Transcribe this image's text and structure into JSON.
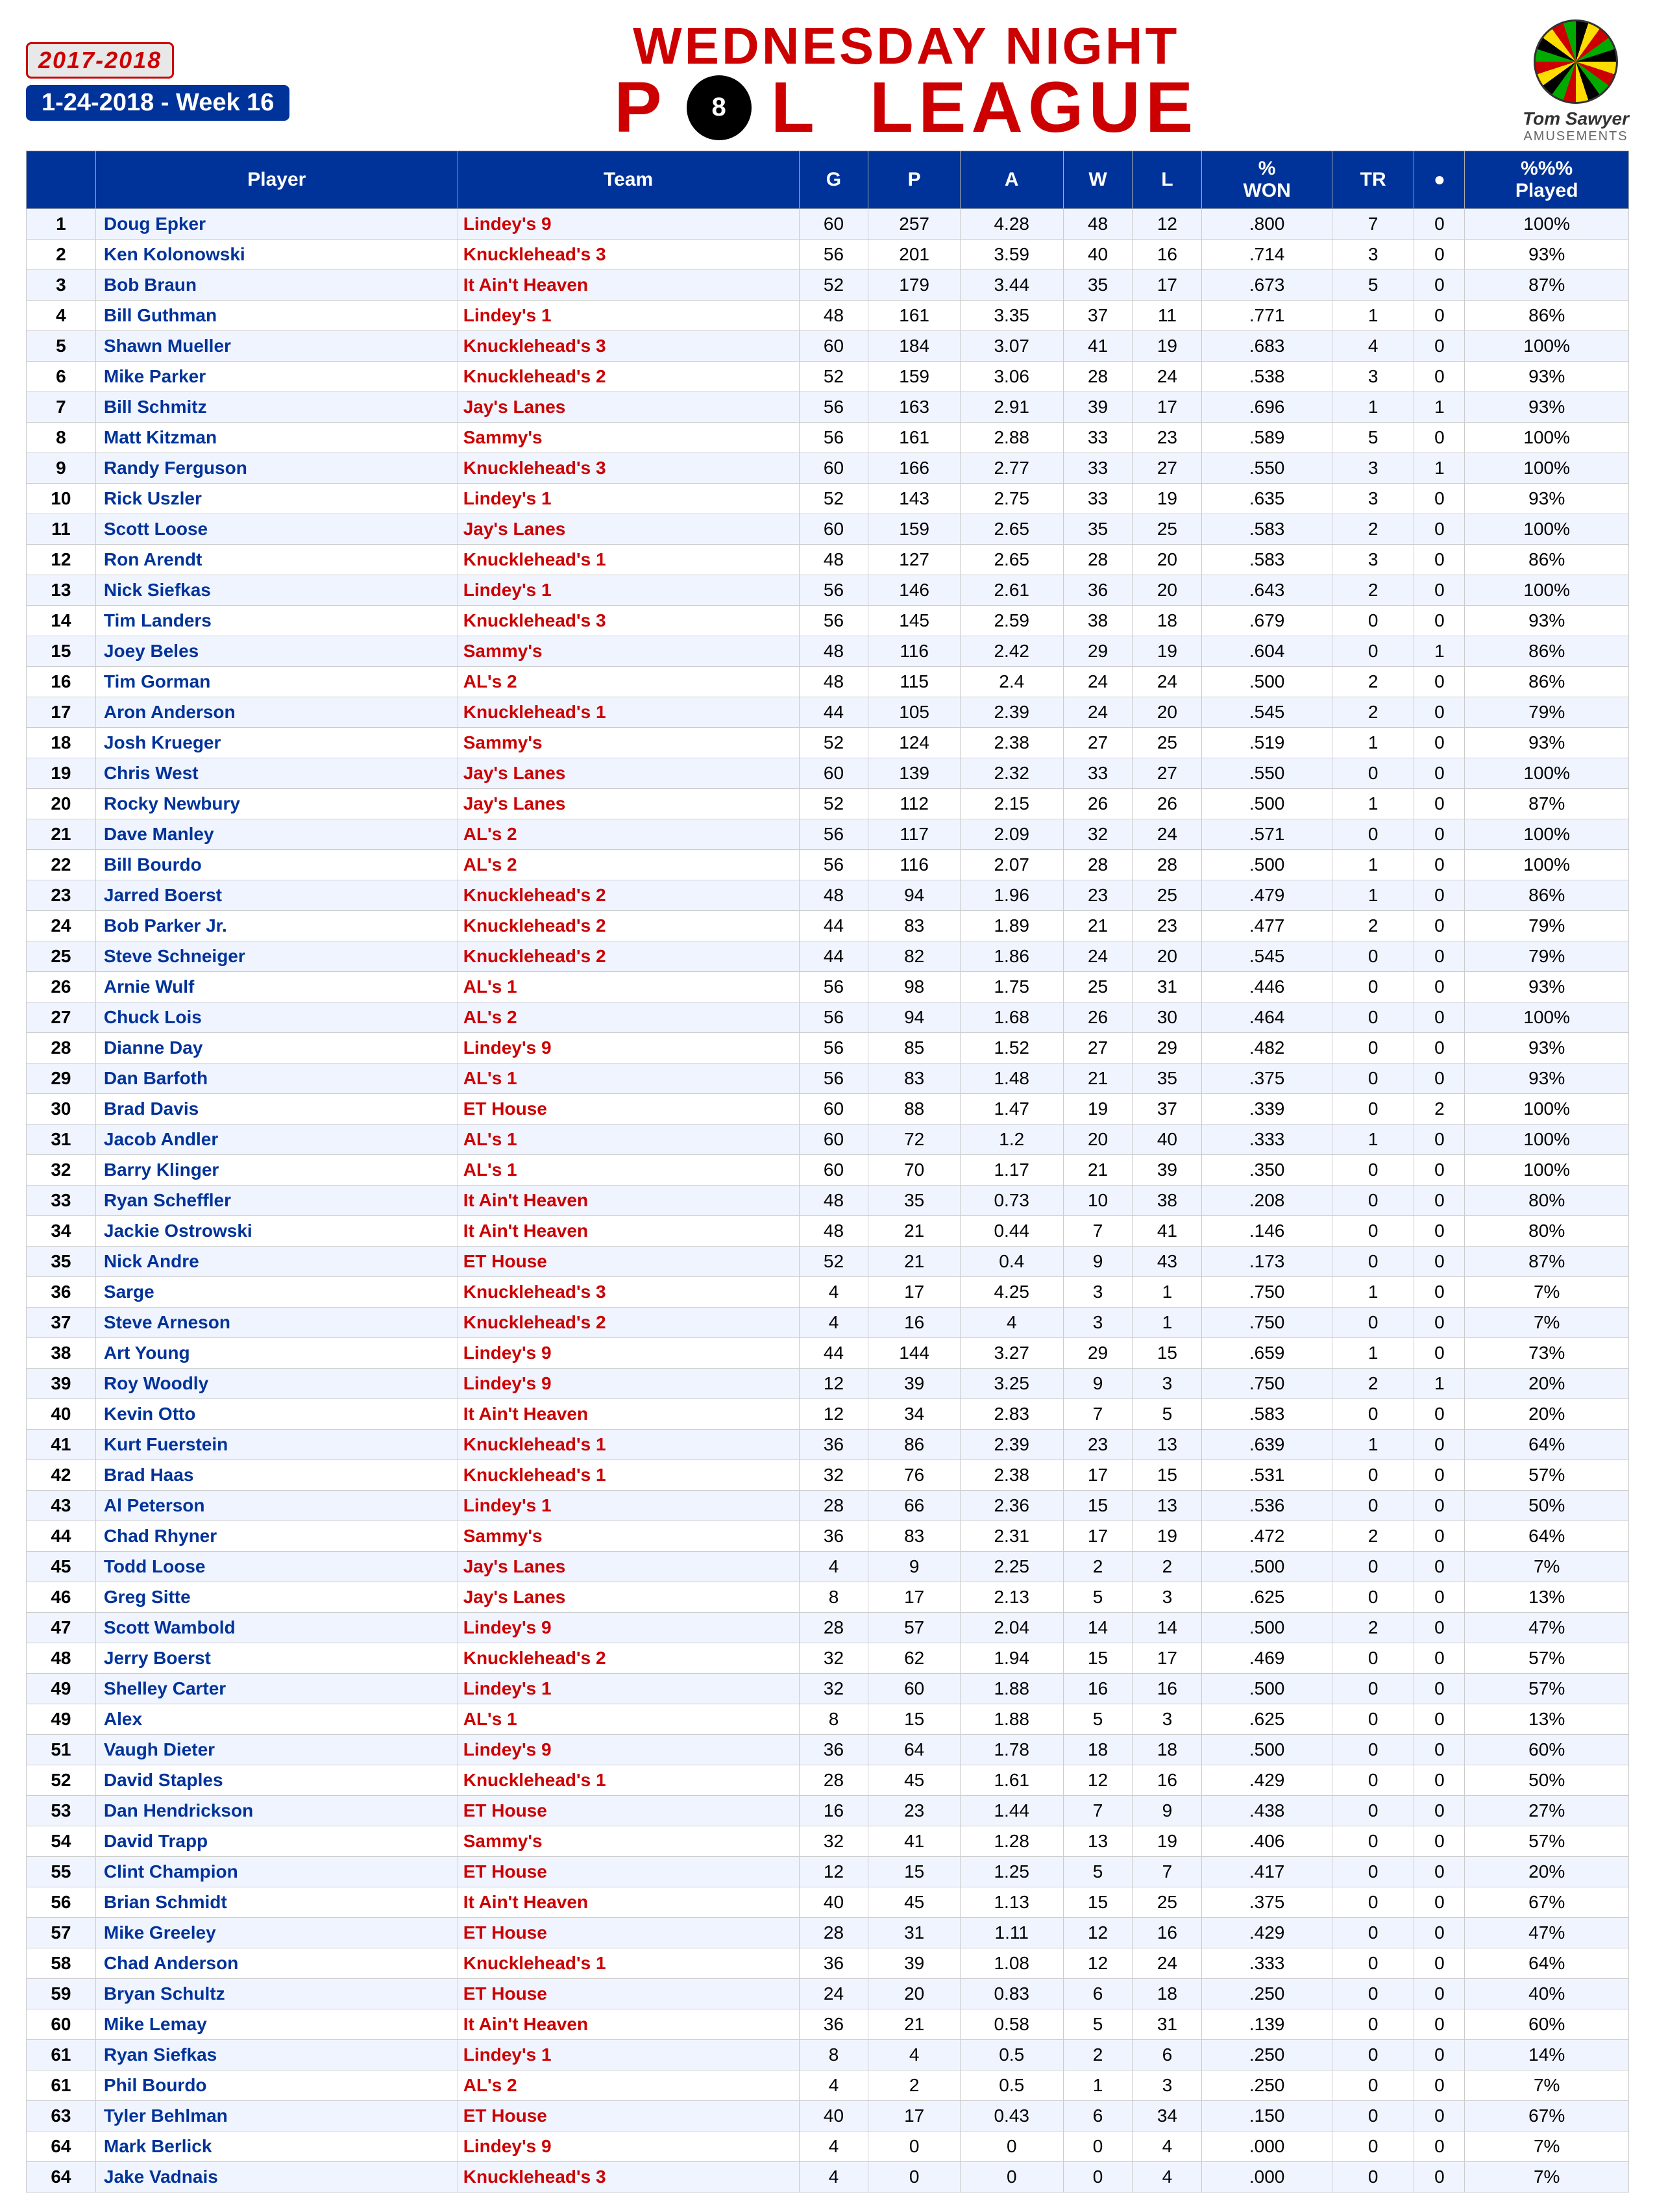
{
  "header": {
    "year": "2017-2018",
    "week": "1-24-2018 - Week 16",
    "title1": "WEDNESDAY NIGHT",
    "title2": "P",
    "title3": "L LEAGUE",
    "brand": "Tom Sawyer",
    "brand_sub": "AMUSEMENTS"
  },
  "columns": [
    "",
    "Player",
    "Team",
    "G",
    "P",
    "A",
    "W",
    "L",
    "% WON",
    "TR",
    "8",
    "%%% Played"
  ],
  "rows": [
    [
      1,
      "Doug Epker",
      "Lindey's 9",
      60,
      257,
      4.28,
      48,
      12,
      ".800",
      7,
      0,
      "100%"
    ],
    [
      2,
      "Ken Kolonowski",
      "Knucklehead's 3",
      56,
      201,
      3.59,
      40,
      16,
      ".714",
      3,
      0,
      "93%"
    ],
    [
      3,
      "Bob Braun",
      "It Ain't Heaven",
      52,
      179,
      3.44,
      35,
      17,
      ".673",
      5,
      0,
      "87%"
    ],
    [
      4,
      "Bill Guthman",
      "Lindey's 1",
      48,
      161,
      3.35,
      37,
      11,
      ".771",
      1,
      0,
      "86%"
    ],
    [
      5,
      "Shawn Mueller",
      "Knucklehead's 3",
      60,
      184,
      3.07,
      41,
      19,
      ".683",
      4,
      0,
      "100%"
    ],
    [
      6,
      "Mike Parker",
      "Knucklehead's 2",
      52,
      159,
      3.06,
      28,
      24,
      ".538",
      3,
      0,
      "93%"
    ],
    [
      7,
      "Bill Schmitz",
      "Jay's Lanes",
      56,
      163,
      2.91,
      39,
      17,
      ".696",
      1,
      1,
      "93%"
    ],
    [
      8,
      "Matt Kitzman",
      "Sammy's",
      56,
      161,
      2.88,
      33,
      23,
      ".589",
      5,
      0,
      "100%"
    ],
    [
      9,
      "Randy Ferguson",
      "Knucklehead's 3",
      60,
      166,
      2.77,
      33,
      27,
      ".550",
      3,
      1,
      "100%"
    ],
    [
      10,
      "Rick Uszler",
      "Lindey's 1",
      52,
      143,
      2.75,
      33,
      19,
      ".635",
      3,
      0,
      "93%"
    ],
    [
      11,
      "Scott Loose",
      "Jay's Lanes",
      60,
      159,
      2.65,
      35,
      25,
      ".583",
      2,
      0,
      "100%"
    ],
    [
      12,
      "Ron Arendt",
      "Knucklehead's 1",
      48,
      127,
      2.65,
      28,
      20,
      ".583",
      3,
      0,
      "86%"
    ],
    [
      13,
      "Nick Siefkas",
      "Lindey's 1",
      56,
      146,
      2.61,
      36,
      20,
      ".643",
      2,
      0,
      "100%"
    ],
    [
      14,
      "Tim Landers",
      "Knucklehead's 3",
      56,
      145,
      2.59,
      38,
      18,
      ".679",
      0,
      0,
      "93%"
    ],
    [
      15,
      "Joey Beles",
      "Sammy's",
      48,
      116,
      2.42,
      29,
      19,
      ".604",
      0,
      1,
      "86%"
    ],
    [
      16,
      "Tim Gorman",
      "AL's 2",
      48,
      115,
      2.4,
      24,
      24,
      ".500",
      2,
      0,
      "86%"
    ],
    [
      17,
      "Aron Anderson",
      "Knucklehead's 1",
      44,
      105,
      2.39,
      24,
      20,
      ".545",
      2,
      0,
      "79%"
    ],
    [
      18,
      "Josh Krueger",
      "Sammy's",
      52,
      124,
      2.38,
      27,
      25,
      ".519",
      1,
      0,
      "93%"
    ],
    [
      19,
      "Chris West",
      "Jay's Lanes",
      60,
      139,
      2.32,
      33,
      27,
      ".550",
      0,
      0,
      "100%"
    ],
    [
      20,
      "Rocky Newbury",
      "Jay's Lanes",
      52,
      112,
      2.15,
      26,
      26,
      ".500",
      1,
      0,
      "87%"
    ],
    [
      21,
      "Dave Manley",
      "AL's 2",
      56,
      117,
      2.09,
      32,
      24,
      ".571",
      0,
      0,
      "100%"
    ],
    [
      22,
      "Bill Bourdo",
      "AL's 2",
      56,
      116,
      2.07,
      28,
      28,
      ".500",
      1,
      0,
      "100%"
    ],
    [
      23,
      "Jarred Boerst",
      "Knucklehead's 2",
      48,
      94,
      1.96,
      23,
      25,
      ".479",
      1,
      0,
      "86%"
    ],
    [
      24,
      "Bob Parker Jr.",
      "Knucklehead's 2",
      44,
      83,
      1.89,
      21,
      23,
      ".477",
      2,
      0,
      "79%"
    ],
    [
      25,
      "Steve Schneiger",
      "Knucklehead's 2",
      44,
      82,
      1.86,
      24,
      20,
      ".545",
      0,
      0,
      "79%"
    ],
    [
      26,
      "Arnie Wulf",
      "AL's 1",
      56,
      98,
      1.75,
      25,
      31,
      ".446",
      0,
      0,
      "93%"
    ],
    [
      27,
      "Chuck Lois",
      "AL's 2",
      56,
      94,
      1.68,
      26,
      30,
      ".464",
      0,
      0,
      "100%"
    ],
    [
      28,
      "Dianne Day",
      "Lindey's 9",
      56,
      85,
      1.52,
      27,
      29,
      ".482",
      0,
      0,
      "93%"
    ],
    [
      29,
      "Dan Barfoth",
      "AL's 1",
      56,
      83,
      1.48,
      21,
      35,
      ".375",
      0,
      0,
      "93%"
    ],
    [
      30,
      "Brad Davis",
      "ET House",
      60,
      88,
      1.47,
      19,
      37,
      ".339",
      0,
      2,
      "100%"
    ],
    [
      31,
      "Jacob Andler",
      "AL's 1",
      60,
      72,
      1.2,
      20,
      40,
      ".333",
      1,
      0,
      "100%"
    ],
    [
      32,
      "Barry Klinger",
      "AL's 1",
      60,
      70,
      1.17,
      21,
      39,
      ".350",
      0,
      0,
      "100%"
    ],
    [
      33,
      "Ryan Scheffler",
      "It Ain't Heaven",
      48,
      35,
      0.73,
      10,
      38,
      ".208",
      0,
      0,
      "80%"
    ],
    [
      34,
      "Jackie Ostrowski",
      "It Ain't Heaven",
      48,
      21,
      0.44,
      7,
      41,
      ".146",
      0,
      0,
      "80%"
    ],
    [
      35,
      "Nick Andre",
      "ET House",
      52,
      21,
      0.4,
      9,
      43,
      ".173",
      0,
      0,
      "87%"
    ],
    [
      36,
      "Sarge",
      "Knucklehead's 3",
      4,
      17,
      4.25,
      3,
      1,
      ".750",
      1,
      0,
      "7%"
    ],
    [
      37,
      "Steve Arneson",
      "Knucklehead's 2",
      4,
      16,
      4.0,
      3,
      1,
      ".750",
      0,
      0,
      "7%"
    ],
    [
      38,
      "Art Young",
      "Lindey's 9",
      44,
      144,
      3.27,
      29,
      15,
      ".659",
      1,
      0,
      "73%"
    ],
    [
      39,
      "Roy Woodly",
      "Lindey's 9",
      12,
      39,
      3.25,
      9,
      3,
      ".750",
      2,
      1,
      "20%"
    ],
    [
      40,
      "Kevin Otto",
      "It Ain't Heaven",
      12,
      34,
      2.83,
      7,
      5,
      ".583",
      0,
      0,
      "20%"
    ],
    [
      41,
      "Kurt Fuerstein",
      "Knucklehead's 1",
      36,
      86,
      2.39,
      23,
      13,
      ".639",
      1,
      0,
      "64%"
    ],
    [
      42,
      "Brad Haas",
      "Knucklehead's 1",
      32,
      76,
      2.38,
      17,
      15,
      ".531",
      0,
      0,
      "57%"
    ],
    [
      43,
      "Al Peterson",
      "Lindey's 1",
      28,
      66,
      2.36,
      15,
      13,
      ".536",
      0,
      0,
      "50%"
    ],
    [
      44,
      "Chad Rhyner",
      "Sammy's",
      36,
      83,
      2.31,
      17,
      19,
      ".472",
      2,
      0,
      "64%"
    ],
    [
      45,
      "Todd Loose",
      "Jay's Lanes",
      4,
      9,
      2.25,
      2,
      2,
      ".500",
      0,
      0,
      "7%"
    ],
    [
      46,
      "Greg Sitte",
      "Jay's Lanes",
      8,
      17,
      2.13,
      5,
      3,
      ".625",
      0,
      0,
      "13%"
    ],
    [
      47,
      "Scott Wambold",
      "Lindey's 9",
      28,
      57,
      2.04,
      14,
      14,
      ".500",
      2,
      0,
      "47%"
    ],
    [
      48,
      "Jerry Boerst",
      "Knucklehead's 2",
      32,
      62,
      1.94,
      15,
      17,
      ".469",
      0,
      0,
      "57%"
    ],
    [
      49,
      "Shelley Carter",
      "Lindey's 1",
      32,
      60,
      1.88,
      16,
      16,
      ".500",
      0,
      0,
      "57%"
    ],
    [
      49,
      "Alex",
      "AL's 1",
      8,
      15,
      1.88,
      5,
      3,
      ".625",
      0,
      0,
      "13%"
    ],
    [
      51,
      "Vaugh Dieter",
      "Lindey's 9",
      36,
      64,
      1.78,
      18,
      18,
      ".500",
      0,
      0,
      "60%"
    ],
    [
      52,
      "David Staples",
      "Knucklehead's 1",
      28,
      45,
      1.61,
      12,
      16,
      ".429",
      0,
      0,
      "50%"
    ],
    [
      53,
      "Dan Hendrickson",
      "ET House",
      16,
      23,
      1.44,
      7,
      9,
      ".438",
      0,
      0,
      "27%"
    ],
    [
      54,
      "David Trapp",
      "Sammy's",
      32,
      41,
      1.28,
      13,
      19,
      ".406",
      0,
      0,
      "57%"
    ],
    [
      55,
      "Clint Champion",
      "ET House",
      12,
      15,
      1.25,
      5,
      7,
      ".417",
      0,
      0,
      "20%"
    ],
    [
      56,
      "Brian Schmidt",
      "It Ain't Heaven",
      40,
      45,
      1.13,
      15,
      25,
      ".375",
      0,
      0,
      "67%"
    ],
    [
      57,
      "Mike Greeley",
      "ET House",
      28,
      31,
      1.11,
      12,
      16,
      ".429",
      0,
      0,
      "47%"
    ],
    [
      58,
      "Chad Anderson",
      "Knucklehead's 1",
      36,
      39,
      1.08,
      12,
      24,
      ".333",
      0,
      0,
      "64%"
    ],
    [
      59,
      "Bryan Schultz",
      "ET House",
      24,
      20,
      0.83,
      6,
      18,
      ".250",
      0,
      0,
      "40%"
    ],
    [
      60,
      "Mike Lemay",
      "It Ain't Heaven",
      36,
      21,
      0.58,
      5,
      31,
      ".139",
      0,
      0,
      "60%"
    ],
    [
      61,
      "Ryan Siefkas",
      "Lindey's 1",
      8,
      4,
      0.5,
      2,
      6,
      ".250",
      0,
      0,
      "14%"
    ],
    [
      61,
      "Phil Bourdo",
      "AL's 2",
      4,
      2,
      0.5,
      1,
      3,
      ".250",
      0,
      0,
      "7%"
    ],
    [
      63,
      "Tyler Behlman",
      "ET House",
      40,
      17,
      0.43,
      6,
      34,
      ".150",
      0,
      0,
      "67%"
    ],
    [
      64,
      "Mark Berlick",
      "Lindey's 9",
      4,
      0,
      0.0,
      0,
      4,
      ".000",
      0,
      0,
      "7%"
    ],
    [
      64,
      "Jake Vadnais",
      "Knucklehead's 3",
      4,
      0,
      0.0,
      0,
      4,
      ".000",
      0,
      0,
      "7%"
    ]
  ]
}
